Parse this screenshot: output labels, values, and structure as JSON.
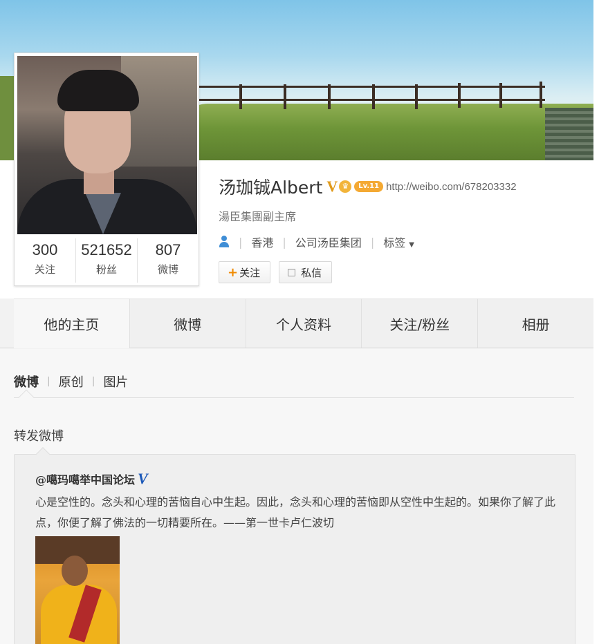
{
  "profile": {
    "name": "汤珈铖Albert",
    "verified_mark": "V",
    "vip_mark": "♛",
    "level": "Lv.11",
    "url": "http://weibo.com/678203332",
    "title": "湯臣集團副主席",
    "location": "香港",
    "company": "公司汤臣集团",
    "tags_label": "标签",
    "follow_label": "关注",
    "message_label": "私信"
  },
  "stats": [
    {
      "value": "300",
      "label": "关注"
    },
    {
      "value": "521652",
      "label": "粉丝"
    },
    {
      "value": "807",
      "label": "微博"
    }
  ],
  "tabs": [
    "他的主页",
    "微博",
    "个人资料",
    "关注/粉丝",
    "相册"
  ],
  "feed": {
    "filters": [
      "微博",
      "原创",
      "图片"
    ],
    "section_title": "转发微博",
    "repost": {
      "author": "@噶玛噶举中国论坛",
      "author_verified": "V",
      "text": "心是空性的。念头和心理的苦恼自心中生起。因此，念头和心理的苦恼即从空性中生起的。如果你了解了此点，你便了解了佛法的一切精要所在。——第一世卡卢仁波切"
    }
  },
  "icons": {
    "user": "user-icon",
    "dropdown": "caret-down-icon",
    "plus": "plus-icon",
    "message": "message-icon"
  },
  "colors": {
    "accent_orange": "#f08a00",
    "verified_gold": "#e09a1a",
    "verified_blue": "#1b58b8",
    "link_blue": "#3f8ed6"
  }
}
